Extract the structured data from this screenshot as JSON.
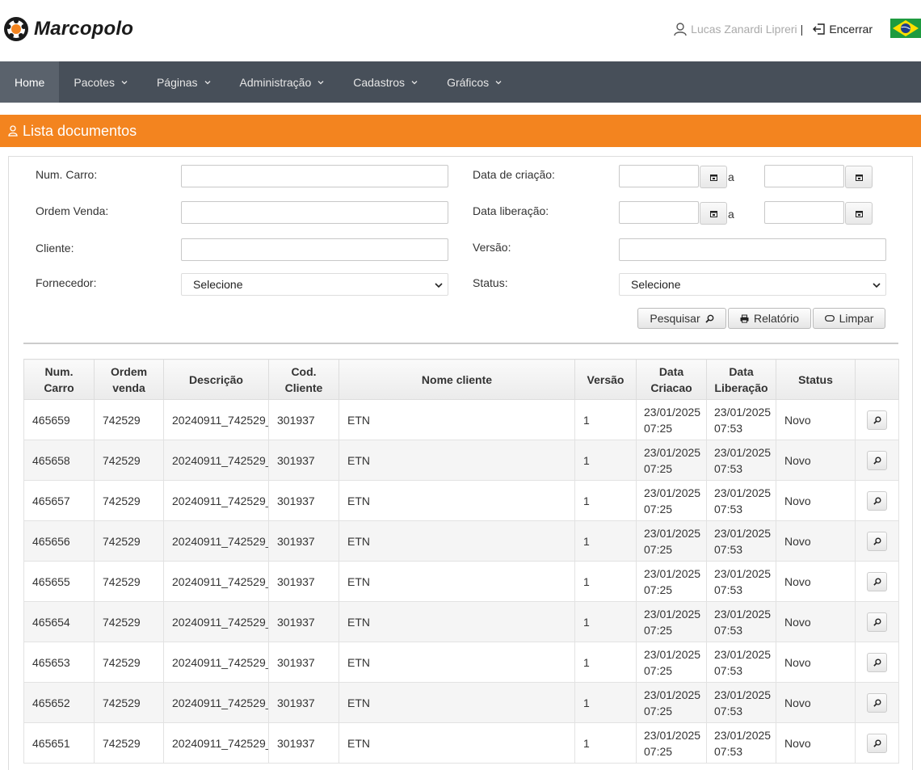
{
  "brand": {
    "name": "Marcopolo"
  },
  "header": {
    "user_name": "Lucas Zanardi Lipreri",
    "separator": "|",
    "logout_label": "Encerrar"
  },
  "nav": [
    {
      "label": "Home",
      "active": true
    },
    {
      "label": "Pacotes",
      "dropdown": true
    },
    {
      "label": "Páginas",
      "dropdown": true
    },
    {
      "label": "Administração",
      "dropdown": true
    },
    {
      "label": "Cadastros",
      "dropdown": true
    },
    {
      "label": "Gráficos",
      "dropdown": true
    }
  ],
  "section": {
    "title": "Lista documentos"
  },
  "filters": {
    "num_carro": {
      "label": "Num. Carro:",
      "value": ""
    },
    "ordem_venda": {
      "label": "Ordem Venda:",
      "value": ""
    },
    "cliente": {
      "label": "Cliente:",
      "value": ""
    },
    "fornecedor": {
      "label": "Fornecedor:",
      "selected": "Selecione"
    },
    "data_criacao": {
      "label": "Data de criação:",
      "from": "",
      "to": "",
      "sep": "a"
    },
    "data_liberacao": {
      "label": "Data liberação:",
      "from": "",
      "to": "",
      "sep": "a"
    },
    "versao": {
      "label": "Versão:",
      "value": ""
    },
    "status": {
      "label": "Status:",
      "selected": "Selecione"
    }
  },
  "actions": {
    "search_label": "Pesquisar",
    "report_label": "Relatório",
    "clear_label": "Limpar"
  },
  "table": {
    "headers": [
      "Num. Carro",
      "Ordem venda",
      "Descrição",
      "Cod. Cliente",
      "Nome cliente",
      "Versão",
      "Data Criacao",
      "Data Liberação",
      "Status",
      ""
    ],
    "rows": [
      [
        "465659",
        "742529",
        "20240911_742529_",
        "301937",
        "ETN",
        "1",
        "23/01/2025 07:25",
        "23/01/2025 07:53",
        "Novo"
      ],
      [
        "465658",
        "742529",
        "20240911_742529_",
        "301937",
        "ETN",
        "1",
        "23/01/2025 07:25",
        "23/01/2025 07:53",
        "Novo"
      ],
      [
        "465657",
        "742529",
        "20240911_742529_",
        "301937",
        "ETN",
        "1",
        "23/01/2025 07:25",
        "23/01/2025 07:53",
        "Novo"
      ],
      [
        "465656",
        "742529",
        "20240911_742529_",
        "301937",
        "ETN",
        "1",
        "23/01/2025 07:25",
        "23/01/2025 07:53",
        "Novo"
      ],
      [
        "465655",
        "742529",
        "20240911_742529_",
        "301937",
        "ETN",
        "1",
        "23/01/2025 07:25",
        "23/01/2025 07:53",
        "Novo"
      ],
      [
        "465654",
        "742529",
        "20240911_742529_",
        "301937",
        "ETN",
        "1",
        "23/01/2025 07:25",
        "23/01/2025 07:53",
        "Novo"
      ],
      [
        "465653",
        "742529",
        "20240911_742529_",
        "301937",
        "ETN",
        "1",
        "23/01/2025 07:25",
        "23/01/2025 07:53",
        "Novo"
      ],
      [
        "465652",
        "742529",
        "20240911_742529_",
        "301937",
        "ETN",
        "1",
        "23/01/2025 07:25",
        "23/01/2025 07:53",
        "Novo"
      ],
      [
        "465651",
        "742529",
        "20240911_742529_",
        "301937",
        "ETN",
        "1",
        "23/01/2025 07:25",
        "23/01/2025 07:53",
        "Novo"
      ]
    ]
  },
  "colors": {
    "nav_bg": "#474f59",
    "accent_orange": "#f3841f"
  }
}
